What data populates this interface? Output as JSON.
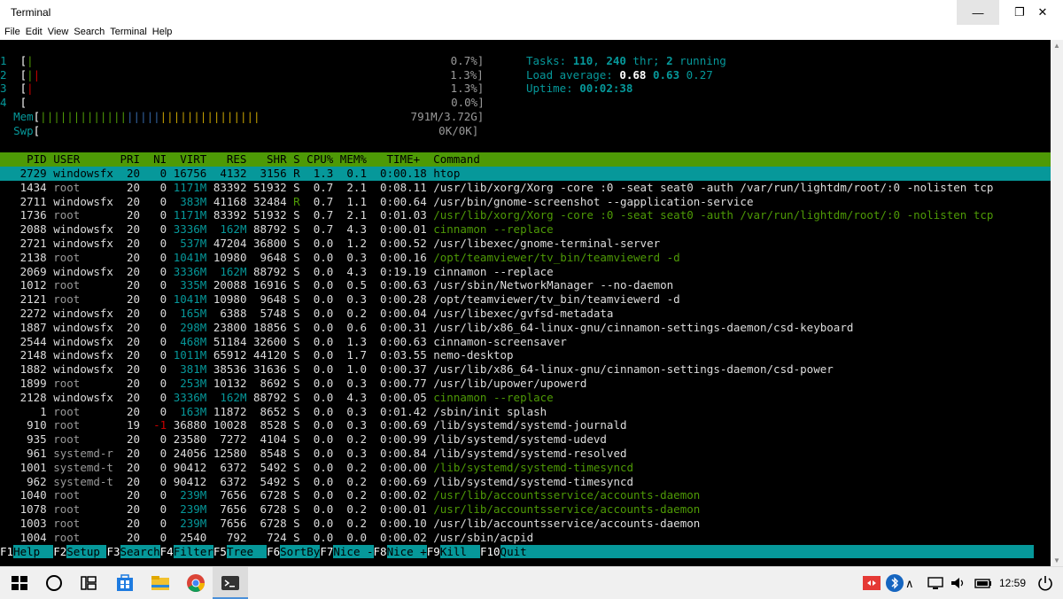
{
  "window": {
    "title": "Terminal"
  },
  "menu": [
    "File",
    "Edit",
    "View",
    "Search",
    "Terminal",
    "Help"
  ],
  "meters": {
    "cpu": [
      {
        "label": "1",
        "value": "0.7%]"
      },
      {
        "label": "2",
        "value": "1.3%]"
      },
      {
        "label": "3",
        "value": "1.3%]"
      },
      {
        "label": "4",
        "value": "0.0%]"
      }
    ],
    "mem_label": "Mem",
    "mem_value": "791M/3.72G]",
    "swp_label": "Swp",
    "swp_value": "0K/0K]"
  },
  "summary": {
    "tasks_label": "Tasks: ",
    "tasks": "110",
    "thr": "240",
    "thr_label": " thr; ",
    "running": "2",
    "running_label": " running",
    "load_label": "Load average: ",
    "load1": "0.68",
    "load5": "0.63",
    "load15": "0.27",
    "uptime_label": "Uptime: ",
    "uptime": "00:02:38"
  },
  "table": {
    "header": "    PID USER      PRI  NI  VIRT   RES   SHR S CPU% MEM%   TIME+  Command",
    "rows": [
      {
        "pid": "2729",
        "user": "windowsfx",
        "pri": "20",
        "ni": "0",
        "virt": "16756",
        "res": "4132",
        "shr": "3156",
        "s": "R",
        "cpu": "1.3",
        "mem": "0.1",
        "time": "0:00.18",
        "cmd": "htop"
      },
      {
        "pid": "1434",
        "user": "root",
        "pri": "20",
        "ni": "0",
        "virt": "1171M",
        "res": "83392",
        "shr": "51932",
        "s": "S",
        "cpu": "0.7",
        "mem": "2.1",
        "time": "0:08.11",
        "cmd": "/usr/lib/xorg/Xorg -core :0 -seat seat0 -auth /var/run/lightdm/root/:0 -nolisten tcp"
      },
      {
        "pid": "2711",
        "user": "windowsfx",
        "pri": "20",
        "ni": "0",
        "virt": "383M",
        "res": "41168",
        "shr": "32484",
        "s": "R",
        "cpu": "0.7",
        "mem": "1.1",
        "time": "0:00.64",
        "cmd": "/usr/bin/gnome-screenshot --gapplication-service"
      },
      {
        "pid": "1736",
        "user": "root",
        "pri": "20",
        "ni": "0",
        "virt": "1171M",
        "res": "83392",
        "shr": "51932",
        "s": "S",
        "cpu": "0.7",
        "mem": "2.1",
        "time": "0:01.03",
        "cmd": "/usr/lib/xorg/Xorg -core :0 -seat seat0 -auth /var/run/lightdm/root/:0 -nolisten tcp"
      },
      {
        "pid": "2088",
        "user": "windowsfx",
        "pri": "20",
        "ni": "0",
        "virt": "3336M",
        "res": "162M",
        "shr": "88792",
        "s": "S",
        "cpu": "0.7",
        "mem": "4.3",
        "time": "0:00.01",
        "cmd": "cinnamon --replace"
      },
      {
        "pid": "2721",
        "user": "windowsfx",
        "pri": "20",
        "ni": "0",
        "virt": "537M",
        "res": "47204",
        "shr": "36800",
        "s": "S",
        "cpu": "0.0",
        "mem": "1.2",
        "time": "0:00.52",
        "cmd": "/usr/libexec/gnome-terminal-server"
      },
      {
        "pid": "2138",
        "user": "root",
        "pri": "20",
        "ni": "0",
        "virt": "1041M",
        "res": "10980",
        "shr": "9648",
        "s": "S",
        "cpu": "0.0",
        "mem": "0.3",
        "time": "0:00.16",
        "cmd": "/opt/teamviewer/tv_bin/teamviewerd -d"
      },
      {
        "pid": "2069",
        "user": "windowsfx",
        "pri": "20",
        "ni": "0",
        "virt": "3336M",
        "res": "162M",
        "shr": "88792",
        "s": "S",
        "cpu": "0.0",
        "mem": "4.3",
        "time": "0:19.19",
        "cmd": "cinnamon --replace"
      },
      {
        "pid": "1012",
        "user": "root",
        "pri": "20",
        "ni": "0",
        "virt": "335M",
        "res": "20088",
        "shr": "16916",
        "s": "S",
        "cpu": "0.0",
        "mem": "0.5",
        "time": "0:00.63",
        "cmd": "/usr/sbin/NetworkManager --no-daemon"
      },
      {
        "pid": "2121",
        "user": "root",
        "pri": "20",
        "ni": "0",
        "virt": "1041M",
        "res": "10980",
        "shr": "9648",
        "s": "S",
        "cpu": "0.0",
        "mem": "0.3",
        "time": "0:00.28",
        "cmd": "/opt/teamviewer/tv_bin/teamviewerd -d"
      },
      {
        "pid": "2272",
        "user": "windowsfx",
        "pri": "20",
        "ni": "0",
        "virt": "165M",
        "res": "6388",
        "shr": "5748",
        "s": "S",
        "cpu": "0.0",
        "mem": "0.2",
        "time": "0:00.04",
        "cmd": "/usr/libexec/gvfsd-metadata"
      },
      {
        "pid": "1887",
        "user": "windowsfx",
        "pri": "20",
        "ni": "0",
        "virt": "298M",
        "res": "23800",
        "shr": "18856",
        "s": "S",
        "cpu": "0.0",
        "mem": "0.6",
        "time": "0:00.31",
        "cmd": "/usr/lib/x86_64-linux-gnu/cinnamon-settings-daemon/csd-keyboard"
      },
      {
        "pid": "2544",
        "user": "windowsfx",
        "pri": "20",
        "ni": "0",
        "virt": "468M",
        "res": "51184",
        "shr": "32600",
        "s": "S",
        "cpu": "0.0",
        "mem": "1.3",
        "time": "0:00.63",
        "cmd": "cinnamon-screensaver"
      },
      {
        "pid": "2148",
        "user": "windowsfx",
        "pri": "20",
        "ni": "0",
        "virt": "1011M",
        "res": "65912",
        "shr": "44120",
        "s": "S",
        "cpu": "0.0",
        "mem": "1.7",
        "time": "0:03.55",
        "cmd": "nemo-desktop"
      },
      {
        "pid": "1882",
        "user": "windowsfx",
        "pri": "20",
        "ni": "0",
        "virt": "381M",
        "res": "38536",
        "shr": "31636",
        "s": "S",
        "cpu": "0.0",
        "mem": "1.0",
        "time": "0:00.37",
        "cmd": "/usr/lib/x86_64-linux-gnu/cinnamon-settings-daemon/csd-power"
      },
      {
        "pid": "1899",
        "user": "root",
        "pri": "20",
        "ni": "0",
        "virt": "253M",
        "res": "10132",
        "shr": "8692",
        "s": "S",
        "cpu": "0.0",
        "mem": "0.3",
        "time": "0:00.77",
        "cmd": "/usr/lib/upower/upowerd"
      },
      {
        "pid": "2128",
        "user": "windowsfx",
        "pri": "20",
        "ni": "0",
        "virt": "3336M",
        "res": "162M",
        "shr": "88792",
        "s": "S",
        "cpu": "0.0",
        "mem": "4.3",
        "time": "0:00.05",
        "cmd": "cinnamon --replace"
      },
      {
        "pid": "1",
        "user": "root",
        "pri": "20",
        "ni": "0",
        "virt": "163M",
        "res": "11872",
        "shr": "8652",
        "s": "S",
        "cpu": "0.0",
        "mem": "0.3",
        "time": "0:01.42",
        "cmd": "/sbin/init splash"
      },
      {
        "pid": "910",
        "user": "root",
        "pri": "19",
        "ni": "-1",
        "virt": "36880",
        "res": "10028",
        "shr": "8528",
        "s": "S",
        "cpu": "0.0",
        "mem": "0.3",
        "time": "0:00.69",
        "cmd": "/lib/systemd/systemd-journald"
      },
      {
        "pid": "935",
        "user": "root",
        "pri": "20",
        "ni": "0",
        "virt": "23580",
        "res": "7272",
        "shr": "4104",
        "s": "S",
        "cpu": "0.0",
        "mem": "0.2",
        "time": "0:00.99",
        "cmd": "/lib/systemd/systemd-udevd"
      },
      {
        "pid": "961",
        "user": "systemd-r",
        "pri": "20",
        "ni": "0",
        "virt": "24056",
        "res": "12580",
        "shr": "8548",
        "s": "S",
        "cpu": "0.0",
        "mem": "0.3",
        "time": "0:00.84",
        "cmd": "/lib/systemd/systemd-resolved"
      },
      {
        "pid": "1001",
        "user": "systemd-t",
        "pri": "20",
        "ni": "0",
        "virt": "90412",
        "res": "6372",
        "shr": "5492",
        "s": "S",
        "cpu": "0.0",
        "mem": "0.2",
        "time": "0:00.00",
        "cmd": "/lib/systemd/systemd-timesyncd"
      },
      {
        "pid": "962",
        "user": "systemd-t",
        "pri": "20",
        "ni": "0",
        "virt": "90412",
        "res": "6372",
        "shr": "5492",
        "s": "S",
        "cpu": "0.0",
        "mem": "0.2",
        "time": "0:00.69",
        "cmd": "/lib/systemd/systemd-timesyncd"
      },
      {
        "pid": "1040",
        "user": "root",
        "pri": "20",
        "ni": "0",
        "virt": "239M",
        "res": "7656",
        "shr": "6728",
        "s": "S",
        "cpu": "0.0",
        "mem": "0.2",
        "time": "0:00.02",
        "cmd": "/usr/lib/accountsservice/accounts-daemon"
      },
      {
        "pid": "1078",
        "user": "root",
        "pri": "20",
        "ni": "0",
        "virt": "239M",
        "res": "7656",
        "shr": "6728",
        "s": "S",
        "cpu": "0.0",
        "mem": "0.2",
        "time": "0:00.01",
        "cmd": "/usr/lib/accountsservice/accounts-daemon"
      },
      {
        "pid": "1003",
        "user": "root",
        "pri": "20",
        "ni": "0",
        "virt": "239M",
        "res": "7656",
        "shr": "6728",
        "s": "S",
        "cpu": "0.0",
        "mem": "0.2",
        "time": "0:00.10",
        "cmd": "/usr/lib/accountsservice/accounts-daemon"
      },
      {
        "pid": "1004",
        "user": "root",
        "pri": "20",
        "ni": "0",
        "virt": "2540",
        "res": "792",
        "shr": "724",
        "s": "S",
        "cpu": "0.0",
        "mem": "0.0",
        "time": "0:00.02",
        "cmd": "/usr/sbin/acpid"
      }
    ]
  },
  "fkeys": [
    {
      "key": "F1",
      "label": "Help  "
    },
    {
      "key": "F2",
      "label": "Setup "
    },
    {
      "key": "F3",
      "label": "Search"
    },
    {
      "key": "F4",
      "label": "Filter"
    },
    {
      "key": "F5",
      "label": "Tree  "
    },
    {
      "key": "F6",
      "label": "SortBy"
    },
    {
      "key": "F7",
      "label": "Nice -"
    },
    {
      "key": "F8",
      "label": "Nice +"
    },
    {
      "key": "F9",
      "label": "Kill  "
    },
    {
      "key": "F10",
      "label": "Quit  "
    }
  ],
  "taskbar": {
    "clock": "12:59"
  },
  "colors": {
    "header_bg": "#4e9a06",
    "selected_bg": "#06989a",
    "fkey_bg": "#06989a"
  }
}
